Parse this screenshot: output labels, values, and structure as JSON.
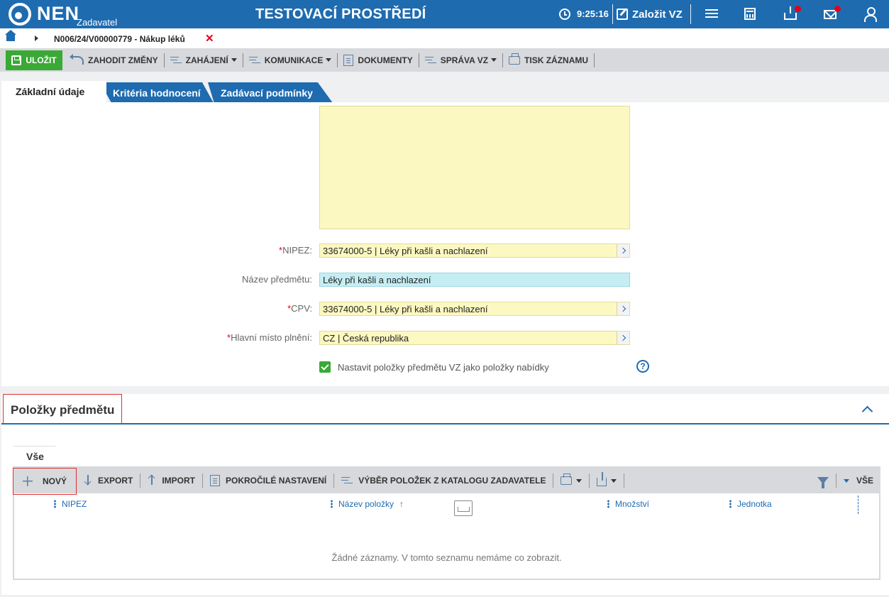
{
  "app": {
    "logo": "NEN",
    "logo_sub": "Zadavatel",
    "env_title": "TESTOVACÍ PROSTŘEDÍ",
    "time": "9:25:16",
    "create_label": "Založit VZ"
  },
  "breadcrumb": {
    "title": "N006/24/V00000779 - Nákup léků",
    "close": "✕"
  },
  "toolbar": {
    "save": "ULOŽIT",
    "discard": "ZAHODIT ZMĚNY",
    "start": "ZAHÁJENÍ",
    "communication": "KOMUNIKACE",
    "documents": "DOKUMENTY",
    "management": "SPRÁVA VZ",
    "print": "TISK ZÁZNAMU"
  },
  "tabs": {
    "basic": "Základní údaje",
    "criteria": "Kritéria hodnocení",
    "conditions": "Zadávací podmínky"
  },
  "form": {
    "nipez_label": "NIPEZ:",
    "nipez_value": "33674000-5 | Léky při kašli a nachlazení",
    "subject_label": "Název předmětu:",
    "subject_value": "Léky při kašli a nachlazení",
    "cpv_label": "CPV:",
    "cpv_value": "33674000-5 | Léky při kašli a nachlazení",
    "place_label": "Hlavní místo plnění:",
    "place_value": "CZ | Česká republika",
    "checkbox_label": "Nastavit položky předmětu VZ jako položky nabídky",
    "help": "?",
    "required_mark": "*"
  },
  "items_section": {
    "title": "Položky předmětu",
    "subtab": "Vše",
    "new": "NOVÝ",
    "export": "EXPORT",
    "import": "IMPORT",
    "advanced": "POKROČILÉ NASTAVENÍ",
    "catalog": "VÝBĚR POLOŽEK Z KATALOGU ZADAVATELE",
    "all": "VŠE",
    "columns": [
      "NIPEZ",
      "Název položky",
      "Množství",
      "Jednotka"
    ],
    "sort_indicator": "↑",
    "empty": "Žádné záznamy. V tomto seznamu nemáme co zobrazit."
  },
  "colors": {
    "brand": "#1e6bb0",
    "save": "#3aa935",
    "field": "#fcf8c1",
    "field_readonly": "#c5eef4",
    "highlight": "#e03030"
  }
}
